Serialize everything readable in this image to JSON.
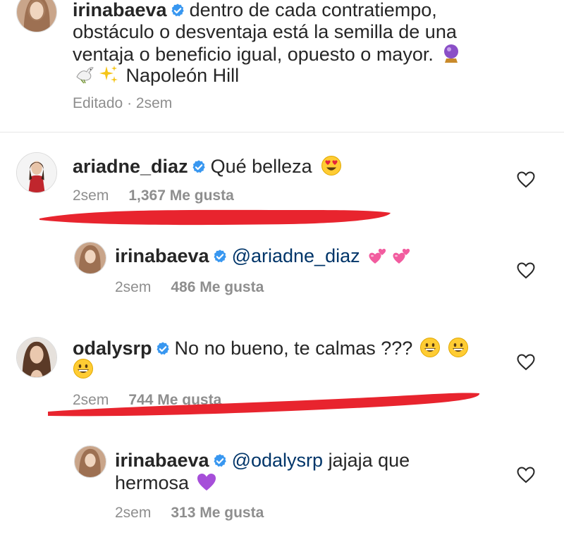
{
  "caption": {
    "username": "irinabaeva",
    "line1": "dentro de cada contratiempo,",
    "line2": "obstáculo o desventaja está la semilla de una",
    "line3": "ventaja o beneficio igual, opuesto o mayor.",
    "line4": "Napoleón Hill",
    "edited_label": "Editado",
    "separator": "·",
    "time": "2sem"
  },
  "comments": [
    {
      "username": "ariadne_diaz",
      "text": "Qué belleza",
      "time": "2sem",
      "likes": "1,367 Me gusta"
    },
    {
      "username": "irinabaeva",
      "mention": "@ariadne_diaz",
      "time": "2sem",
      "likes": "486 Me gusta"
    },
    {
      "username": "odalysrp",
      "text": "No no bueno, te calmas ???",
      "time": "2sem",
      "likes": "744 Me gusta"
    },
    {
      "username": "irinabaeva",
      "mention": "@odalysrp",
      "text_line1": "jajaja que",
      "text_line2": "hermosa",
      "time": "2sem",
      "likes": "313 Me gusta"
    }
  ],
  "icons": {
    "verified": "verified-badge-icon",
    "like": "heart-outline-icon",
    "emojis": [
      "crystal-ball-emoji",
      "dove-emoji",
      "sparkles-emoji",
      "heart-eyes-emoji",
      "two-hearts-emoji",
      "grinning-face-emoji",
      "purple-heart-emoji"
    ]
  },
  "colors": {
    "text": "#262626",
    "muted": "#8e8e8e",
    "verified": "#3897f0",
    "mention": "#003569",
    "annotation": "#e8242e"
  }
}
